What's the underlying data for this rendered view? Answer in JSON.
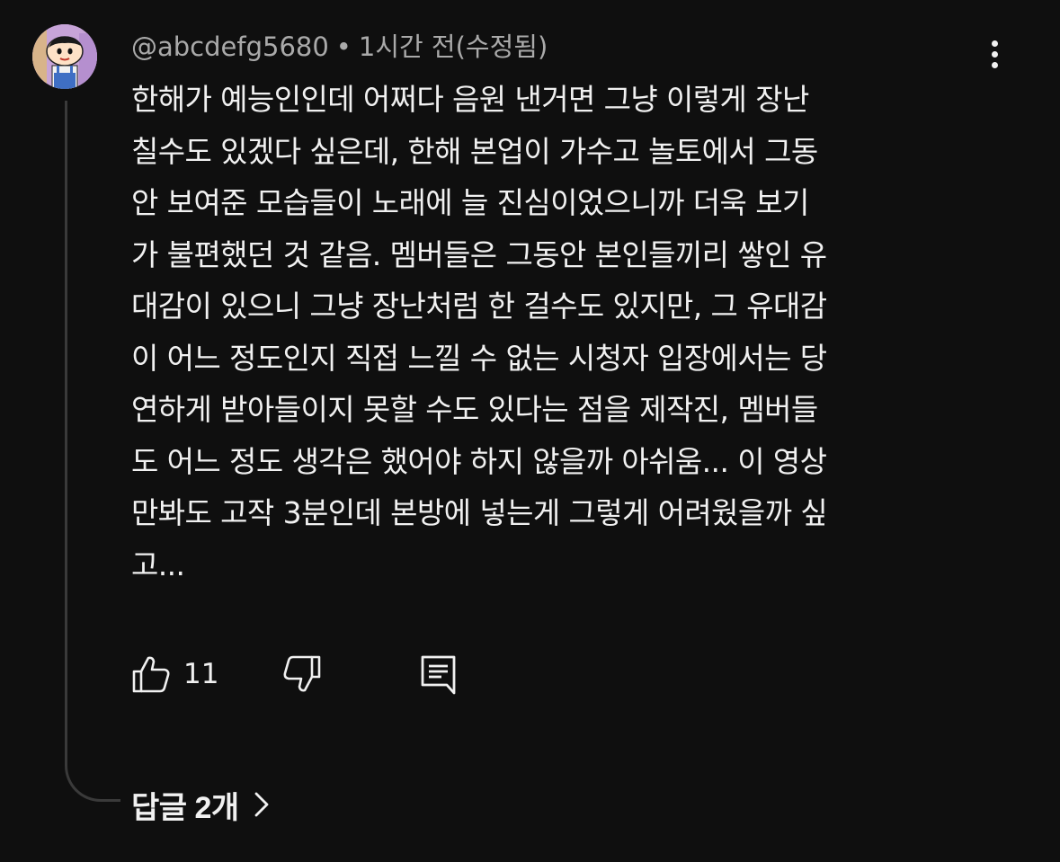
{
  "comment": {
    "author": "@abcdefg5680",
    "separator": "•",
    "timestamp": "1시간 전(수정됨)",
    "body": "한해가 예능인인데 어쩌다 음원 낸거면 그냥 이렇게 장난\n칠수도 있겠다 싶은데, 한해 본업이 가수고 놀토에서 그동\n안 보여준 모습들이 노래에 늘 진심이었으니까 더욱 보기\n가 불편했던 것 같음. 멤버들은 그동안 본인들끼리 쌓인 유\n대감이 있으니 그냥 장난처럼 한 걸수도 있지만, 그 유대감\n이 어느 정도인지 직접 느낄 수 없는 시청자 입장에서는 당\n연하게 받아들이지 못할 수도 있다는 점을 제작진, 멤버들\n도 어느 정도 생각은 했어야 하지 않을까 아쉬움... 이 영상\n만봐도 고작 3분인데 본방에 넣는게 그렇게 어려웠을까 싶\n고...",
    "like_count": "11"
  },
  "icons": {
    "avatar": "cartoon-avatar",
    "more": "more-vert-icon",
    "like": "thumb-up-icon",
    "dislike": "thumb-down-icon",
    "reply": "comment-icon",
    "chevron": "chevron-right-icon"
  },
  "replies": {
    "label": "답글 2개"
  },
  "colors": {
    "background": "#0f0f0f",
    "primary_text": "#f1f1f1",
    "secondary_text": "#aaaaaa",
    "thread_line": "#3a3a3a"
  }
}
